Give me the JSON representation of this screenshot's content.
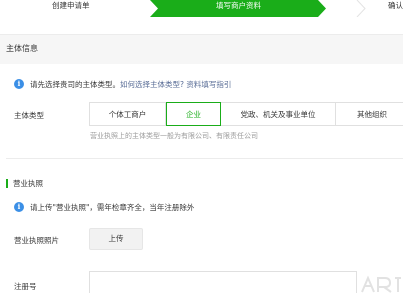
{
  "steps": [
    {
      "label": "创建申请单",
      "state": "done"
    },
    {
      "label": "填写商户资料",
      "state": "current"
    },
    {
      "label": "确认",
      "state": "todo"
    }
  ],
  "colors": {
    "brand_green": "#1aad19",
    "info_blue": "#3b8fe6",
    "link": "#576b95"
  },
  "main_info": {
    "title": "主体信息",
    "notice_text": "请先选择贵司的主体类型。",
    "notice_link": "如何选择主体类型? 资料填写指引",
    "type_label": "主体类型",
    "type_options": [
      "个体工商户",
      "企业",
      "党政、机关及事业单位",
      "其他组织"
    ],
    "selected_type": "企业",
    "type_hint": "营业执照上的主体类型一般为有限公司、有限责任公司"
  },
  "license": {
    "title": "营业执照",
    "notice_text": "请上传\"营业执照\"，需年检章齐全，当年注册除外",
    "photo_label": "营业执照照片",
    "upload_label": "上传",
    "reg_label": "注册号"
  },
  "icons": {
    "info": "info-icon"
  }
}
